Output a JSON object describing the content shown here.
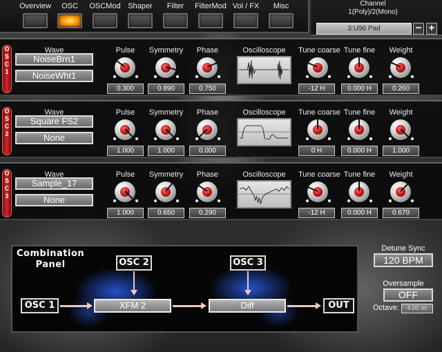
{
  "tabs": [
    {
      "label": "Overview",
      "active": false
    },
    {
      "label": "OSC",
      "active": true
    },
    {
      "label": "OSCMod",
      "active": false
    },
    {
      "label": "Shaper",
      "active": false
    },
    {
      "label": "Filter",
      "active": false
    },
    {
      "label": "FilterMod",
      "active": false
    },
    {
      "label": "Vol / FX",
      "active": false
    },
    {
      "label": "Misc",
      "active": false
    }
  ],
  "channel": {
    "title": "Channel",
    "mode": "1(Poly)/2(Mono)",
    "preset": "3:U96 Pad",
    "minus_label": "−",
    "plus_label": "+"
  },
  "labels": {
    "wave": "Wave",
    "pulse": "Pulse",
    "symmetry": "Symmetry",
    "phase": "Phase",
    "oscilloscope": "Oscilloscope",
    "tune_coarse": "Tune coarse",
    "tune_fine": "Tune fine",
    "weight": "Weight"
  },
  "oscillators": [
    {
      "tag": [
        "O",
        "S",
        "C",
        "1"
      ],
      "wave1": "NoiseBrn1",
      "wave2": "NoiseWht1",
      "pulse": "0.300",
      "symmetry": "0.890",
      "phase": "0.750",
      "tune_coarse": "-12 H",
      "tune_fine": "0.000 H",
      "weight": "0.260",
      "knob_levels": {
        "pulse": 0.3,
        "symmetry": 0.89,
        "phase": 0.75,
        "tune_coarse": 0.25,
        "tune_fine": 0.5,
        "weight": 0.26
      }
    },
    {
      "tag": [
        "O",
        "S",
        "C",
        "2"
      ],
      "wave1": "Square FS2",
      "wave2": "None",
      "pulse": "1.000",
      "symmetry": "1.000",
      "phase": "0.000",
      "tune_coarse": "0 H",
      "tune_fine": "0.000 H",
      "weight": "1.000",
      "knob_levels": {
        "pulse": 1.0,
        "symmetry": 1.0,
        "phase": 0.0,
        "tune_coarse": 0.5,
        "tune_fine": 0.5,
        "weight": 1.0
      }
    },
    {
      "tag": [
        "O",
        "S",
        "C",
        "3"
      ],
      "wave1": "Sample_17",
      "wave2": "None",
      "pulse": "1.000",
      "symmetry": "0.650",
      "phase": "0.290",
      "tune_coarse": "-12 H",
      "tune_fine": "0.000 H",
      "weight": "0.670",
      "knob_levels": {
        "pulse": 1.0,
        "symmetry": 0.65,
        "phase": 0.29,
        "tune_coarse": 0.25,
        "tune_fine": 0.5,
        "weight": 0.67
      }
    }
  ],
  "combination": {
    "title_line1": "Combination",
    "title_line2": "Panel",
    "osc1": "OSC 1",
    "osc2": "OSC 2",
    "osc3": "OSC 3",
    "out": "OUT",
    "mix1": "XFM 2",
    "mix2": "Diff"
  },
  "right_panel": {
    "detune_sync_label": "Detune Sync",
    "detune_sync_value": "120 BPM",
    "oversample_label": "Oversample",
    "oversample_value": "OFF",
    "octave_label": "Octave:",
    "octave_value": "4.00 oc"
  },
  "colors": {
    "accent": "#ff9b00",
    "osc_tag": "#c82a2a",
    "knob_cap": "#c11515"
  }
}
